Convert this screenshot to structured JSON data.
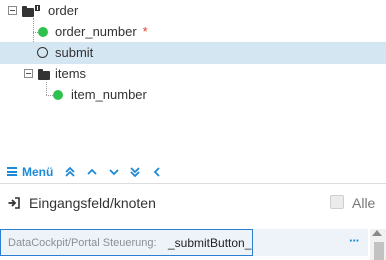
{
  "tree": {
    "nodes": [
      {
        "label": "order",
        "type": "folder-root",
        "required": false
      },
      {
        "label": "order_number",
        "type": "field",
        "required": true,
        "required_mark": "*"
      },
      {
        "label": "submit",
        "type": "event",
        "required": false,
        "selected": true
      },
      {
        "label": "items",
        "type": "folder",
        "required": false
      },
      {
        "label": "item_number",
        "type": "field",
        "required": false
      }
    ]
  },
  "menubar": {
    "menu_label": "Menü",
    "icons": [
      "double-chevron-up",
      "chevron-up",
      "chevron-down",
      "double-chevron-down",
      "chevron-left"
    ]
  },
  "field_panel": {
    "title": "Eingangsfeld/knoten",
    "all_checkbox_label": "Alle",
    "all_checked": false,
    "input_prefix": "DataCockpit/Portal Steuerung:",
    "input_value": "_submitButton_",
    "more_button": "···"
  },
  "colors": {
    "accent": "#1d8ad6",
    "selection": "#d5e6f3",
    "status_green": "#2fc14e",
    "required_red": "#e0402e",
    "input_border": "#2b7fd0"
  }
}
